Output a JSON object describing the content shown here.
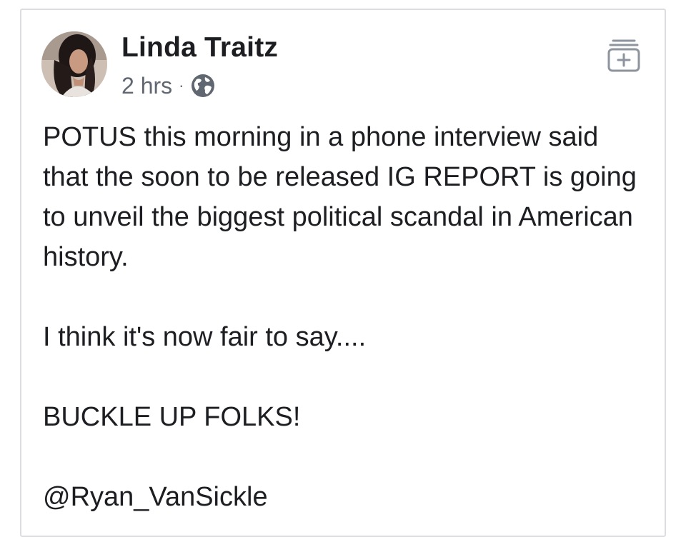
{
  "post": {
    "author_name": "Linda Traitz",
    "timestamp": "2 hrs",
    "separator": "·",
    "audience_icon": "globe-icon",
    "paragraphs": [
      "POTUS this morning in a phone interview said that the soon to be released IG REPORT is going to unveil the biggest political scandal in American history.",
      "I think it's now fair to say....",
      "BUCKLE UP FOLKS!",
      "@Ryan_VanSickle"
    ],
    "save_icon": "save-collection-plus-icon"
  },
  "colors": {
    "name_text": "#1c1e21",
    "meta_text": "#606770",
    "card_border": "#dcdde1",
    "background": "#ffffff"
  }
}
